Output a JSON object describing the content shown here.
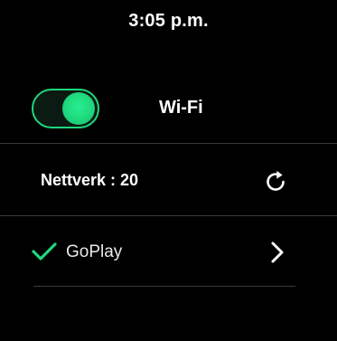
{
  "status_bar": {
    "time": "3:05 p.m."
  },
  "wifi": {
    "label": "Wi-Fi",
    "enabled": true,
    "toggle_color": "#1fd77e"
  },
  "networks_header": {
    "label": "Nettverk : 20",
    "refresh_icon": "refresh-icon"
  },
  "networks": [
    {
      "name": "GoPlay",
      "connected": true,
      "status_icon": "check-icon",
      "action_icon": "chevron-right-icon"
    }
  ],
  "colors": {
    "background": "#000000",
    "accent": "#1fd77e",
    "text": "#ffffff",
    "divider": "#3a3a3a"
  }
}
